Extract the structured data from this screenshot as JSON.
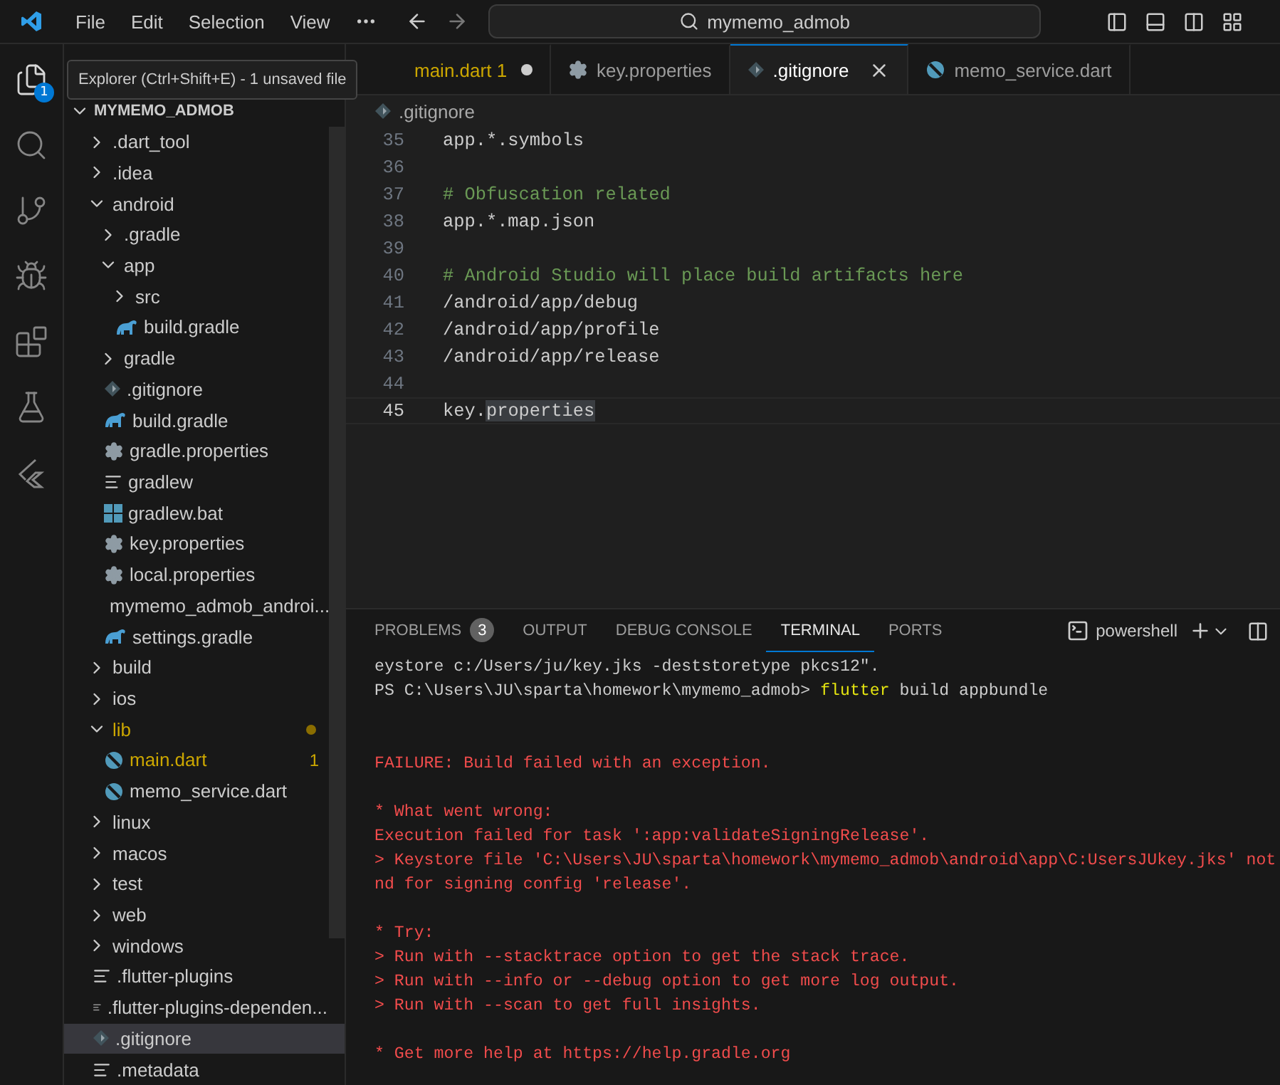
{
  "title_bar": {
    "menus": [
      "File",
      "Edit",
      "Selection",
      "View"
    ],
    "search": "mymemo_admob"
  },
  "activity_bar": {
    "items": [
      {
        "selected": true,
        "badge": "1"
      },
      {
        "selected": false
      },
      {
        "selected": false
      },
      {
        "selected": false
      },
      {
        "selected": false
      },
      {
        "selected": false
      },
      {
        "selected": false
      }
    ]
  },
  "tooltip": "Explorer (Ctrl+Shift+E) - 1 unsaved file",
  "explorer": {
    "title": "MYMEMO_ADMOB",
    "items": [
      {
        "name": ".dart_tool",
        "kind": "folder",
        "expanded": false,
        "selected": false,
        "modified": false
      },
      {
        "name": ".idea",
        "kind": "folder",
        "expanded": false,
        "selected": false,
        "modified": false
      },
      {
        "name": "android",
        "kind": "folder",
        "expanded": true,
        "selected": false,
        "modified": false,
        "children": [
          {
            "name": ".gradle",
            "kind": "folder",
            "expanded": false,
            "selected": false,
            "modified": false
          },
          {
            "name": "app",
            "kind": "folder",
            "expanded": true,
            "selected": false,
            "modified": false,
            "children": [
              {
                "name": "src",
                "kind": "folder",
                "expanded": false,
                "selected": false,
                "modified": false
              },
              {
                "name": "build.gradle",
                "kind": "gradle",
                "selected": false,
                "modified": false
              }
            ]
          },
          {
            "name": "gradle",
            "kind": "folder",
            "expanded": false,
            "selected": false,
            "modified": false
          },
          {
            "name": ".gitignore",
            "kind": "git",
            "selected": false,
            "modified": false
          },
          {
            "name": "build.gradle",
            "kind": "gradle",
            "selected": false,
            "modified": false
          },
          {
            "name": "gradle.properties",
            "kind": "gear",
            "selected": false,
            "modified": false
          },
          {
            "name": "gradlew",
            "kind": "lines",
            "selected": false,
            "modified": false
          },
          {
            "name": "gradlew.bat",
            "kind": "windows",
            "selected": false,
            "modified": false
          },
          {
            "name": "key.properties",
            "kind": "gear",
            "selected": false,
            "modified": false
          },
          {
            "name": "local.properties",
            "kind": "gear",
            "selected": false,
            "modified": false
          },
          {
            "name": "mymemo_admob_androi...",
            "kind": "rss",
            "selected": false,
            "modified": false
          },
          {
            "name": "settings.gradle",
            "kind": "gradle",
            "selected": false,
            "modified": false
          }
        ]
      },
      {
        "name": "build",
        "kind": "folder",
        "expanded": false,
        "selected": false,
        "modified": false
      },
      {
        "name": "ios",
        "kind": "folder",
        "expanded": false,
        "selected": false,
        "modified": false
      },
      {
        "name": "lib",
        "kind": "folder",
        "expanded": true,
        "selected": false,
        "modified": true,
        "children": [
          {
            "name": "main.dart",
            "kind": "dart",
            "selected": false,
            "modified": true,
            "problems": "1"
          },
          {
            "name": "memo_service.dart",
            "kind": "dart",
            "selected": false,
            "modified": false
          }
        ]
      },
      {
        "name": "linux",
        "kind": "folder",
        "expanded": false,
        "selected": false,
        "modified": false
      },
      {
        "name": "macos",
        "kind": "folder",
        "expanded": false,
        "selected": false,
        "modified": false
      },
      {
        "name": "test",
        "kind": "folder",
        "expanded": false,
        "selected": false,
        "modified": false
      },
      {
        "name": "web",
        "kind": "folder",
        "expanded": false,
        "selected": false,
        "modified": false
      },
      {
        "name": "windows",
        "kind": "folder",
        "expanded": false,
        "selected": false,
        "modified": false
      },
      {
        "name": ".flutter-plugins",
        "kind": "lines",
        "selected": false,
        "modified": false
      },
      {
        "name": ".flutter-plugins-dependen...",
        "kind": "lines",
        "selected": false,
        "modified": false
      },
      {
        "name": ".gitignore",
        "kind": "git",
        "selected": true,
        "modified": false
      },
      {
        "name": ".metadata",
        "kind": "lines",
        "selected": false,
        "modified": false
      }
    ]
  },
  "editor_tabs": [
    {
      "label": "main.dart",
      "badge": "1",
      "modified": true,
      "selected": false
    },
    {
      "label": "key.properties",
      "kind": "gear",
      "modified": false,
      "selected": false
    },
    {
      "label": ".gitignore",
      "kind": "git",
      "modified": false,
      "selected": true
    },
    {
      "label": "memo_service.dart",
      "kind": "dart",
      "modified": false,
      "selected": false
    }
  ],
  "breadcrumb": ".gitignore",
  "code_lines": [
    {
      "number": "35",
      "kind": "plain",
      "text": "app.*.symbols",
      "current": false
    },
    {
      "number": "36",
      "current": false
    },
    {
      "number": "37",
      "kind": "comment",
      "text": "# Obfuscation related",
      "current": false
    },
    {
      "number": "38",
      "kind": "plain",
      "text": "app.*.map.json",
      "current": false
    },
    {
      "number": "39",
      "current": false
    },
    {
      "number": "40",
      "kind": "comment",
      "text": "# Android Studio will place build artifacts here",
      "current": false
    },
    {
      "number": "41",
      "kind": "plain",
      "text": "/android/app/debug",
      "current": false
    },
    {
      "number": "42",
      "kind": "plain",
      "text": "/android/app/profile",
      "current": false
    },
    {
      "number": "43",
      "kind": "plain",
      "text": "/android/app/release",
      "current": false
    },
    {
      "number": "44",
      "current": false
    },
    {
      "number": "45",
      "kind": "plain",
      "parts": [
        {
          "text": "key.",
          "highlighted": false
        },
        {
          "text": "properties",
          "highlighted": true
        }
      ],
      "current": true
    }
  ],
  "panel": {
    "tabs": [
      {
        "label": "PROBLEMS",
        "badge": "3",
        "selected": false
      },
      {
        "label": "OUTPUT",
        "selected": false
      },
      {
        "label": "DEBUG CONSOLE",
        "selected": false
      },
      {
        "label": "TERMINAL",
        "selected": true
      },
      {
        "label": "PORTS",
        "selected": false
      }
    ],
    "shell": "powershell",
    "terminal_lines": [
      {
        "kind": "plain",
        "text": "eystore c:/Users/ju/key.jks -deststoretype pkcs12\"."
      },
      {
        "kind": "prompt",
        "text": "PS C:\\Users\\JU\\sparta\\homework\\mymemo_admob> ",
        "command": "flutter",
        "args": " build appbundle"
      },
      {
        "kind": "blank"
      },
      {
        "kind": "blank"
      },
      {
        "kind": "error",
        "text": "FAILURE: Build failed with an exception."
      },
      {
        "kind": "blank"
      },
      {
        "kind": "error",
        "text": "* What went wrong:"
      },
      {
        "kind": "error",
        "text": "Execution failed for task ':app:validateSigningRelease'."
      },
      {
        "kind": "error",
        "text": "> Keystore file 'C:\\Users\\JU\\sparta\\homework\\mymemo_admob\\android\\app\\C:UsersJUkey.jks' not"
      },
      {
        "kind": "error",
        "text": "nd for signing config 'release'."
      },
      {
        "kind": "blank"
      },
      {
        "kind": "error",
        "text": "* Try:"
      },
      {
        "kind": "error",
        "text": "> Run with --stacktrace option to get the stack trace."
      },
      {
        "kind": "error",
        "text": "> Run with --info or --debug option to get more log output."
      },
      {
        "kind": "error",
        "text": "> Run with --scan to get full insights."
      },
      {
        "kind": "blank"
      },
      {
        "kind": "error",
        "text": "* Get more help at https://help.gradle.org"
      }
    ]
  }
}
